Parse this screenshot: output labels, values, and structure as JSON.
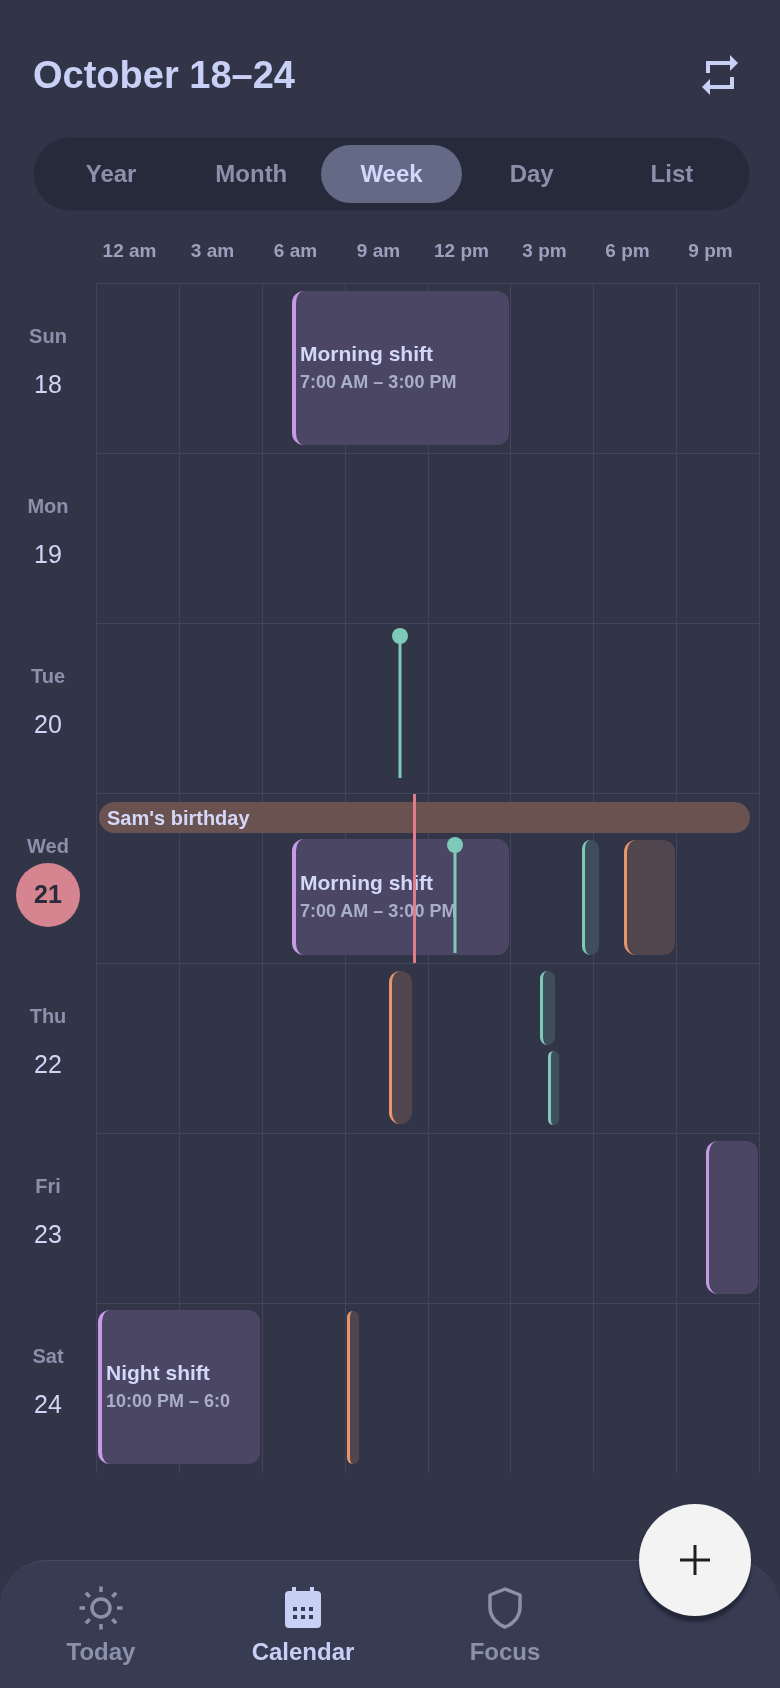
{
  "header": {
    "title": "October 18–24"
  },
  "view_tabs": [
    {
      "label": "Year",
      "selected": false
    },
    {
      "label": "Month",
      "selected": false
    },
    {
      "label": "Week",
      "selected": true
    },
    {
      "label": "Day",
      "selected": false
    },
    {
      "label": "List",
      "selected": false
    }
  ],
  "hour_labels": [
    "12 am",
    "3 am",
    "6 am",
    "9 am",
    "12 pm",
    "3 pm",
    "6 pm",
    "9 pm"
  ],
  "days": [
    {
      "name": "Sun",
      "date": "18",
      "today": false,
      "now_marker": false,
      "events": [
        {
          "kind": "timed",
          "color": "#c79ae6",
          "title": "Morning shift",
          "time": "7:00 AM – 3:00 PM"
        }
      ]
    },
    {
      "name": "Mon",
      "date": "19",
      "today": false,
      "now_marker": false
    },
    {
      "name": "Tue",
      "date": "20",
      "today": false,
      "now_marker": false,
      "events": [
        {
          "kind": "pin",
          "color": "#7ecab8"
        }
      ]
    },
    {
      "name": "Wed",
      "date": "21",
      "today": true,
      "now_marker": true,
      "events": [
        {
          "kind": "all_day",
          "color": "#6a5250",
          "title": "Sam's birthday"
        },
        {
          "kind": "timed",
          "color": "#c79ae6",
          "title": "Morning shift",
          "time": "7:00 AM – 3:00 PM"
        },
        {
          "kind": "pin",
          "color": "#7ecab8"
        },
        {
          "kind": "timed",
          "color": "#7ecab8"
        },
        {
          "kind": "timed",
          "color": "#e8956b"
        }
      ]
    },
    {
      "name": "Thu",
      "date": "22",
      "today": false,
      "now_marker": false,
      "events": [
        {
          "kind": "timed",
          "color": "#e8956b"
        },
        {
          "kind": "timed",
          "color": "#7ecab8"
        },
        {
          "kind": "timed",
          "color": "#7ecab8"
        }
      ]
    },
    {
      "name": "Fri",
      "date": "23",
      "today": false,
      "now_marker": false,
      "events": [
        {
          "kind": "timed",
          "color": "#c79ae6"
        }
      ]
    },
    {
      "name": "Sat",
      "date": "24",
      "today": false,
      "now_marker": false,
      "events": [
        {
          "kind": "timed",
          "color": "#c79ae6",
          "title": "Night shift",
          "time": "10:00 PM – 6:0"
        },
        {
          "kind": "timed",
          "color": "#e8956b"
        }
      ]
    }
  ],
  "bottom_nav": [
    {
      "label": "Today",
      "selected": false
    },
    {
      "label": "Calendar",
      "selected": true
    },
    {
      "label": "Focus",
      "selected": false
    }
  ]
}
